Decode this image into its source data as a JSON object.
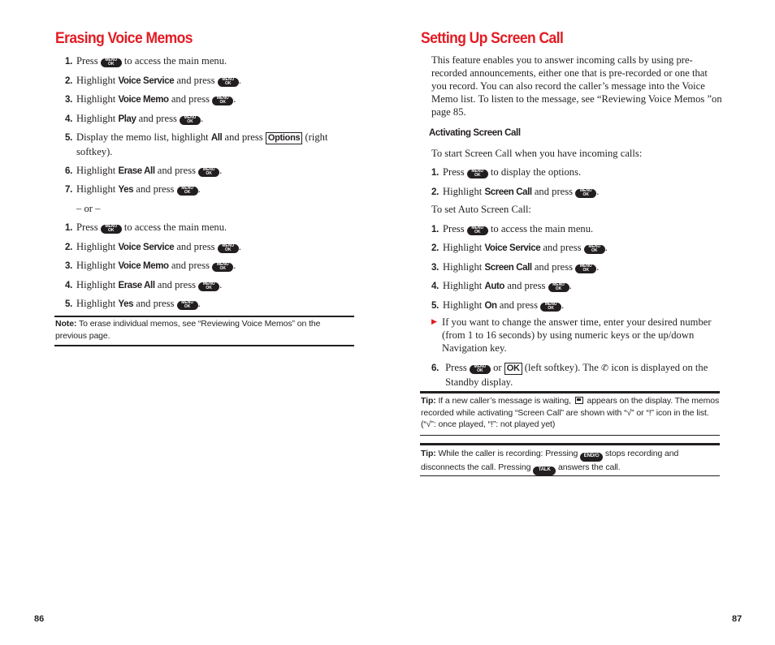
{
  "left_page": {
    "title": "Erasing Voice Memos",
    "steps_a": [
      {
        "num": "1.",
        "pre": "Press",
        "post": "to access the main menu."
      },
      {
        "num": "2.",
        "pre": "Highlight",
        "bold": "Voice Service",
        "mid": "and press",
        "post": "."
      },
      {
        "num": "3.",
        "pre": "Highlight",
        "bold": "Voice Memo",
        "mid": "and press",
        "post": "."
      },
      {
        "num": "4.",
        "pre": "Highlight",
        "bold": "Play",
        "mid": "and press",
        "post": "."
      },
      {
        "num": "5.",
        "pre": "Display the memo list, highlight",
        "bold": "All",
        "mid": "and press",
        "softkey": "Options",
        "post": "(right softkey)."
      },
      {
        "num": "6.",
        "pre": "Highlight",
        "bold": "Erase All",
        "mid": "and press",
        "post": "."
      },
      {
        "num": "7.",
        "pre": "Highlight",
        "bold": "Yes",
        "mid": "and press",
        "post": "."
      }
    ],
    "or_text": "– or –",
    "steps_b": [
      {
        "num": "1.",
        "pre": "Press",
        "post": "to access the main menu."
      },
      {
        "num": "2.",
        "pre": "Highlight",
        "bold": "Voice Service",
        "mid": "and press",
        "post": "."
      },
      {
        "num": "3.",
        "pre": "Highlight",
        "bold": "Voice Memo",
        "mid": "and press",
        "post": "."
      },
      {
        "num": "4.",
        "pre": "Highlight",
        "bold": "Erase All",
        "mid": "and press",
        "post": "."
      },
      {
        "num": "5.",
        "pre": "Highlight",
        "bold": "Yes",
        "mid": "and press",
        "post": "."
      }
    ],
    "note": {
      "label": "Note:",
      "text": "To erase individual memos, see “Reviewing Voice Memos” on the previous page."
    },
    "page_number": "86"
  },
  "right_page": {
    "title": "Setting Up Screen Call",
    "intro": "This feature enables you to answer incoming calls by using pre-recorded announcements, either one that is pre-recorded or one that you record. You can also record the caller’s message into the Voice Memo list. To listen to the message, see “Reviewing Voice Memos ”on page 85.",
    "subheading": "Activating Screen Call",
    "start_text": "To start Screen Call when you have incoming calls:",
    "steps_a": [
      {
        "num": "1.",
        "pre": "Press",
        "post": "to display the options."
      },
      {
        "num": "2.",
        "pre": "Highlight",
        "bold": "Screen Call",
        "mid": "and press",
        "post": "."
      }
    ],
    "auto_text": "To set Auto Screen Call:",
    "steps_b": [
      {
        "num": "1.",
        "pre": "Press",
        "post": "to access the main menu."
      },
      {
        "num": "2.",
        "pre": "Highlight",
        "bold": "Voice Service",
        "mid": "and press",
        "post": "."
      },
      {
        "num": "3.",
        "pre": "Highlight",
        "bold": "Screen Call",
        "mid": "and press",
        "post": "."
      },
      {
        "num": "4.",
        "pre": "Highlight",
        "bold": "Auto",
        "mid": "and press",
        "post": "."
      },
      {
        "num": "5.",
        "pre": "Highlight",
        "bold": "On",
        "mid": "and press",
        "post": "."
      }
    ],
    "bullet_text": "If you want to change the answer time, enter your desired number (from 1 to 16 seconds) by using numeric keys or the up/down Navigation key.",
    "step6": {
      "num": "6.",
      "pre": "Press",
      "or": "or",
      "softkey": "OK",
      "mid": "(left softkey). The",
      "post": "icon is displayed on the Standby display."
    },
    "tip1": {
      "label": "Tip:",
      "pre": "If a new caller’s message is waiting,",
      "post": "appears on the display. The memos recorded while activating “Screen Call” are shown with “√” or “!” icon in the list. (“√”: once played, “!”: not played yet)"
    },
    "tip2": {
      "label": "Tip:",
      "pre": "While the caller is recording: Pressing",
      "mid": "stops recording and disconnects the call. Pressing",
      "post": "answers the call."
    },
    "page_number": "87"
  },
  "keys": {
    "menu_top": "MENU",
    "menu_bottom": "OK",
    "end": "END/⏻",
    "talk": "TALK"
  },
  "colors": {
    "heading": "#e31b23",
    "text": "#231f20"
  }
}
